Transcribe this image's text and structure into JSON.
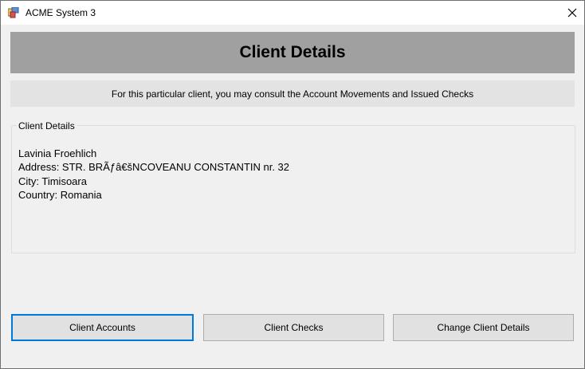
{
  "window": {
    "title": "ACME System 3",
    "app_icon": "app-window-icon",
    "close_icon": "close-icon"
  },
  "header": {
    "title": "Client Details"
  },
  "info": {
    "text": "For this particular client, you may consult the Account Movements and Issued Checks"
  },
  "group": {
    "legend": "Client Details",
    "lines": [
      "Lavinia Froehlich",
      "Address: STR. BRÃƒâ€šNCOVEANU CONSTANTIN nr. 32",
      "City: Timisoara",
      "Country: Romania"
    ]
  },
  "buttons": {
    "client_accounts": "Client Accounts",
    "client_checks": "Client Checks",
    "change_client_details": "Change Client Details"
  },
  "colors": {
    "header_bg": "#a0a0a0",
    "info_bg": "#e3e3e3",
    "focus_border": "#0078d7"
  }
}
